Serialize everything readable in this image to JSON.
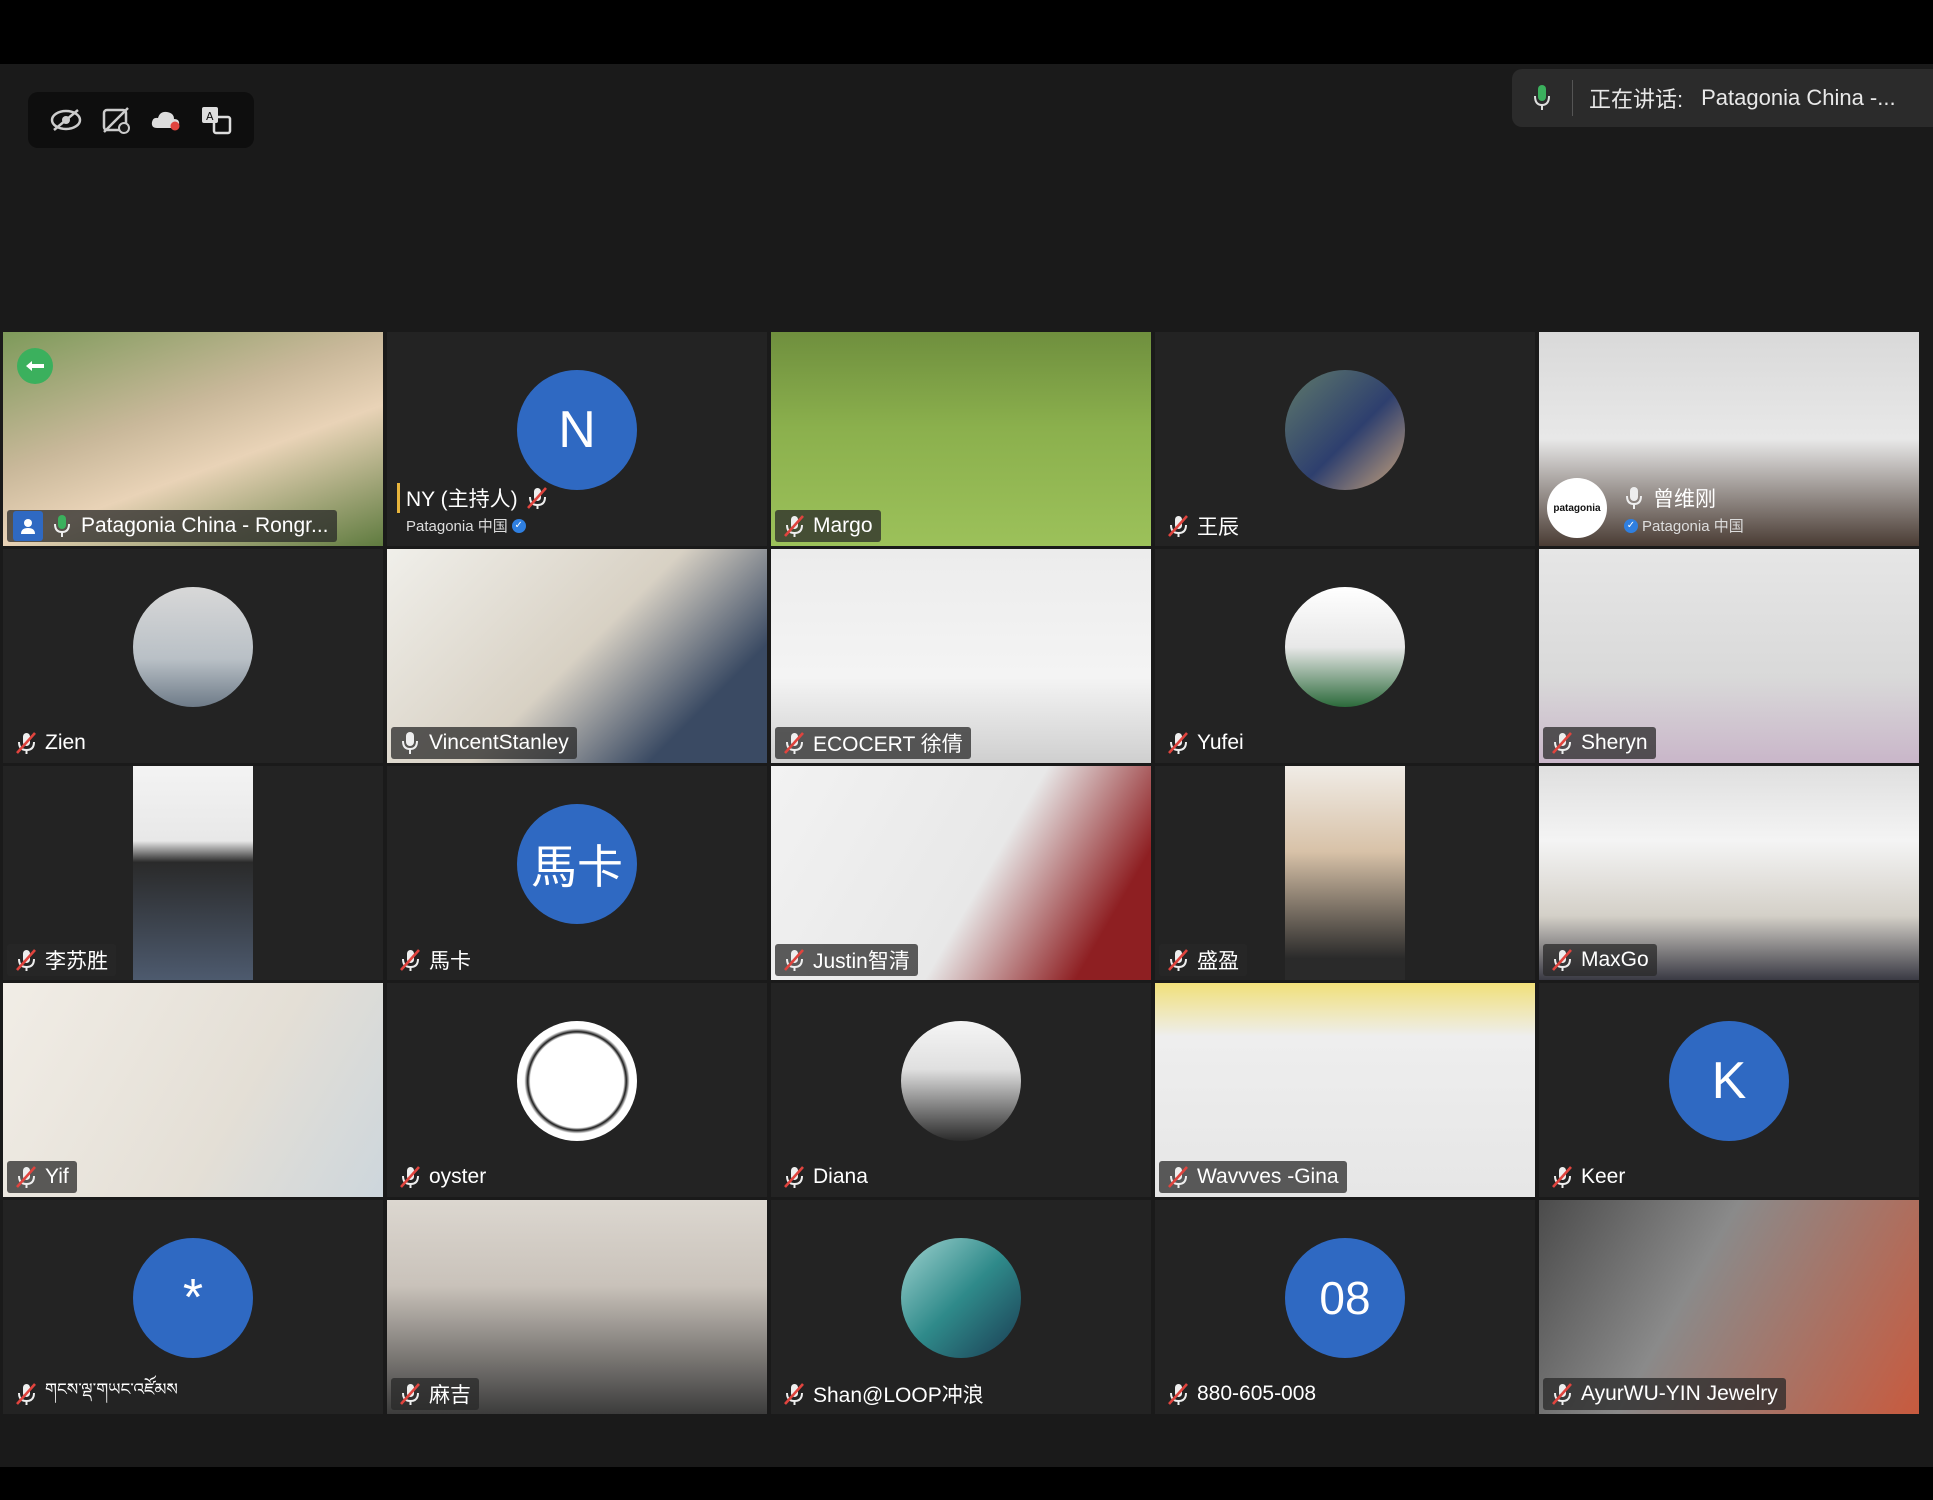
{
  "toolbar": {
    "icons": [
      "hide-self-view-icon",
      "captions-off-icon",
      "cloud-recording-icon",
      "translation-icon"
    ]
  },
  "speaking": {
    "label": "正在讲话:",
    "name": "Patagonia China -..."
  },
  "tiles": [
    {
      "name": "Patagonia China - Rongr...",
      "muted": false,
      "active": true
    },
    {
      "name": "NY (主持人)",
      "subtitle": "Patagonia 中国",
      "avatar": "N",
      "muted": true,
      "host": true
    },
    {
      "name": "Margo",
      "muted": true
    },
    {
      "name": "王辰",
      "muted": true
    },
    {
      "name": "曾维刚",
      "subtitle": "Patagonia 中国",
      "logo": "patagonia",
      "muted": false
    },
    {
      "name": "Zien",
      "muted": true
    },
    {
      "name": "VincentStanley",
      "muted": false
    },
    {
      "name": "ECOCERT 徐倩",
      "muted": true
    },
    {
      "name": "Yufei",
      "muted": true
    },
    {
      "name": "Sheryn",
      "muted": true
    },
    {
      "name": "李苏胜",
      "muted": true
    },
    {
      "name": "馬卡",
      "avatar": "馬卡",
      "muted": true
    },
    {
      "name": "Justin智清",
      "muted": true
    },
    {
      "name": "盛盈",
      "muted": true
    },
    {
      "name": "MaxGo",
      "muted": true
    },
    {
      "name": "Yif",
      "muted": true
    },
    {
      "name": "oyster",
      "muted": true
    },
    {
      "name": "Diana",
      "muted": true
    },
    {
      "name": "Wavvves   -Gina",
      "muted": true
    },
    {
      "name": "Keer",
      "avatar": "K",
      "muted": true
    },
    {
      "name": "གངས་ལྡ་གཡང་འཛོམས",
      "avatar": "*",
      "muted": true
    },
    {
      "name": "麻吉",
      "muted": true
    },
    {
      "name": "Shan@LOOP冲浪",
      "muted": true
    },
    {
      "name": "880-605-008",
      "avatar": "08",
      "muted": true
    },
    {
      "name": "AyurWU-YIN Jewelry",
      "muted": true
    }
  ]
}
